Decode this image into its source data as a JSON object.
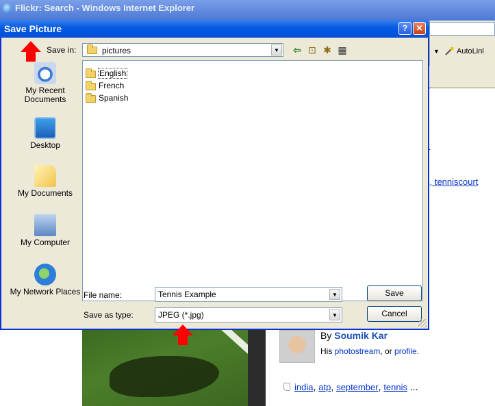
{
  "browser": {
    "title": "Flickr: Search - Windows Internet Explorer",
    "toolbar": {
      "autolink_label": "AutoLinl",
      "dropdown_glyph": "▼"
    }
  },
  "page": {
    "dot": ".",
    "tenniscourt_prefix": "<, ",
    "tenniscourt": "tenniscourt",
    "author": {
      "by": "By ",
      "name": "Soumik Kar",
      "his": "His ",
      "photostream": "photostream",
      "or": ", or ",
      "profile": "profile",
      "end": "."
    },
    "tags": {
      "t1": "india",
      "t2": "atp",
      "t3": "september",
      "t4": "tennis",
      "sep": ", ",
      "more": " ..."
    }
  },
  "dialog": {
    "title": "Save Picture",
    "help": "?",
    "close": "✕",
    "save_in_label": "Save in:",
    "save_in_value": "pictures",
    "places": [
      {
        "label": "My Recent Documents",
        "icon": "recent-documents-icon"
      },
      {
        "label": "Desktop",
        "icon": "desktop-icon"
      },
      {
        "label": "My Documents",
        "icon": "my-documents-icon"
      },
      {
        "label": "My Computer",
        "icon": "my-computer-icon"
      },
      {
        "label": "My Network Places",
        "icon": "network-places-icon"
      }
    ],
    "files": [
      "English",
      "French",
      "Spanish"
    ],
    "file_name_label": "File name:",
    "file_name_value": "Tennis Example",
    "save_type_label": "Save as type:",
    "save_type_value": "JPEG (*.jpg)",
    "save_button": "Save",
    "cancel_button": "Cancel",
    "toolbar_icons": [
      "back-icon",
      "up-folder-icon",
      "new-folder-icon",
      "views-icon"
    ]
  },
  "colors": {
    "titlebar": "#0054e3",
    "dialog_bg": "#ece9d8",
    "annotation": "#ff0000",
    "link": "#0033cc"
  }
}
